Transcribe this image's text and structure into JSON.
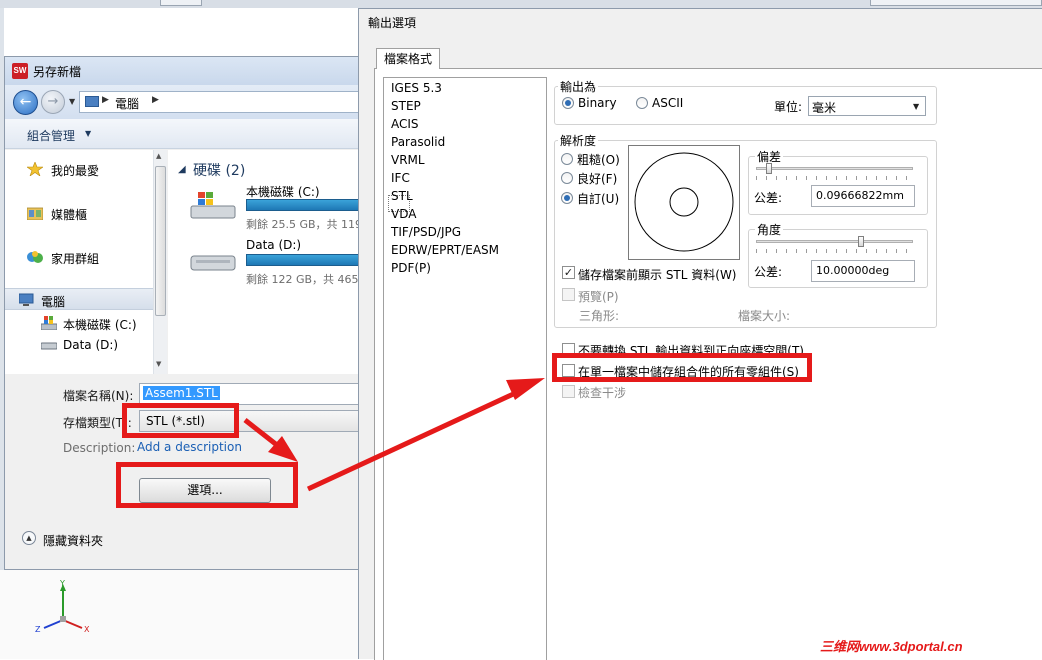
{
  "save_as": {
    "title": "另存新檔",
    "address": {
      "location": "電腦"
    },
    "toolbar": {
      "organize": "組合管理"
    },
    "nav": {
      "favorites": "我的最愛",
      "libraries": "媒體櫃",
      "homegroup": "家用群組",
      "computer": "電腦",
      "local_disk": "本機磁碟 (C:)",
      "data_disk": "Data (D:)"
    },
    "files": {
      "group_label": "硬碟 (2)",
      "drives": [
        {
          "name": "本機磁碟 (C:)",
          "free": "剩餘 25.5 GB，共 119",
          "used_fraction": 0.79
        },
        {
          "name": "Data (D:)",
          "free": "剩餘 122 GB，共 465",
          "used_fraction": 0.74
        }
      ]
    },
    "form": {
      "filename_label": "檔案名稱(N):",
      "filename_value": "Assem1.STL",
      "filetype_label": "存檔類型(T):",
      "filetype_value": "STL (*.stl)",
      "description_label": "Description:",
      "description_link": "Add a description",
      "options_button": "選項...",
      "hide_folders": "隱藏資料夾"
    }
  },
  "export_options": {
    "title": "輸出選項",
    "tab": "檔案格式",
    "formats": [
      "IGES 5.3",
      "STEP",
      "ACIS",
      "Parasolid",
      "VRML",
      "IFC",
      "STL",
      "VDA",
      "TIF/PSD/JPG",
      "EDRW/EPRT/EASM",
      "PDF(P)"
    ],
    "selected_format": "STL",
    "output_as": {
      "label": "輸出為",
      "binary": "Binary",
      "ascii": "ASCII",
      "selected": "Binary",
      "unit_label": "單位:",
      "unit_value": "毫米"
    },
    "resolution": {
      "label": "解析度",
      "coarse": "粗糙(O)",
      "fine": "良好(F)",
      "custom": "自訂(U)",
      "selected": "自訂(U)",
      "deviation_label": "偏差",
      "deviation_tol_label": "公差:",
      "deviation_value": "0.09666822mm",
      "angle_label": "角度",
      "angle_tol_label": "公差:",
      "angle_value": "10.00000deg",
      "show_info": "儲存檔案前顯示 STL 資料(W)",
      "show_info_checked": true,
      "preview": "預覽(P)",
      "triangles_label": "三角形:",
      "filesize_label": "檔案大小:"
    },
    "options": {
      "no_translate": "不要轉換 STL 輸出資料到正向座標空間(T)",
      "save_all_in_one": "在單一檔案中儲存組合件的所有零組件(S)",
      "check_interference": "檢查干涉"
    }
  },
  "watermark": "三维网www.3dportal.cn",
  "colors": {
    "annotation_red": "#e51a1a",
    "accent_blue": "#1a5fb4",
    "selection_blue": "#3399ff"
  },
  "axis_labels": {
    "y": "Y",
    "x": "X",
    "z": "Z"
  }
}
